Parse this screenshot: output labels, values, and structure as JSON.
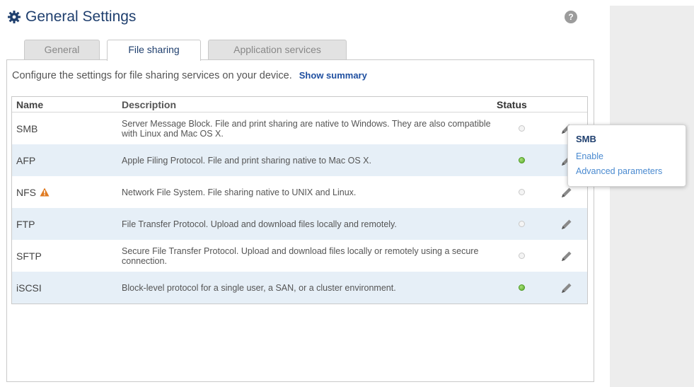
{
  "header": {
    "title": "General Settings",
    "help_label": "?"
  },
  "tabs": [
    {
      "label": "General",
      "active": false
    },
    {
      "label": "File sharing",
      "active": true
    },
    {
      "label": "Application services",
      "active": false
    }
  ],
  "intro": {
    "text": "Configure the settings for file sharing services on your device.",
    "link": "Show summary"
  },
  "table": {
    "columns": {
      "name": "Name",
      "description": "Description",
      "status": "Status"
    },
    "rows": [
      {
        "name": "SMB",
        "description": "Server Message Block. File and print sharing are native to Windows. They are also compatible with Linux and Mac OS X.",
        "status": "off",
        "warning": false
      },
      {
        "name": "AFP",
        "description": "Apple Filing Protocol. File and print sharing native to Mac OS X.",
        "status": "on",
        "warning": false
      },
      {
        "name": "NFS",
        "description": "Network File System. File sharing native to UNIX and Linux.",
        "status": "off",
        "warning": true
      },
      {
        "name": "FTP",
        "description": "File Transfer Protocol. Upload and download files locally and remotely.",
        "status": "off",
        "warning": false
      },
      {
        "name": "SFTP",
        "description": "Secure File Transfer Protocol. Upload and download files locally or remotely using a secure connection.",
        "status": "off",
        "warning": false
      },
      {
        "name": "iSCSI",
        "description": "Block-level protocol for a single user, a SAN, or a cluster environment.",
        "status": "on",
        "warning": false
      }
    ]
  },
  "popup": {
    "title": "SMB",
    "items": [
      "Enable",
      "Advanced parameters"
    ]
  },
  "colors": {
    "title_blue": "#1f3f6e",
    "link_blue": "#4a8ad0",
    "row_alt": "#e6eff7",
    "status_on": "#5aaa2a",
    "warning": "#e07b22"
  },
  "icons": {
    "header": "gear-icon",
    "help": "help-icon",
    "edit": "pencil-icon",
    "warning": "warning-icon"
  }
}
